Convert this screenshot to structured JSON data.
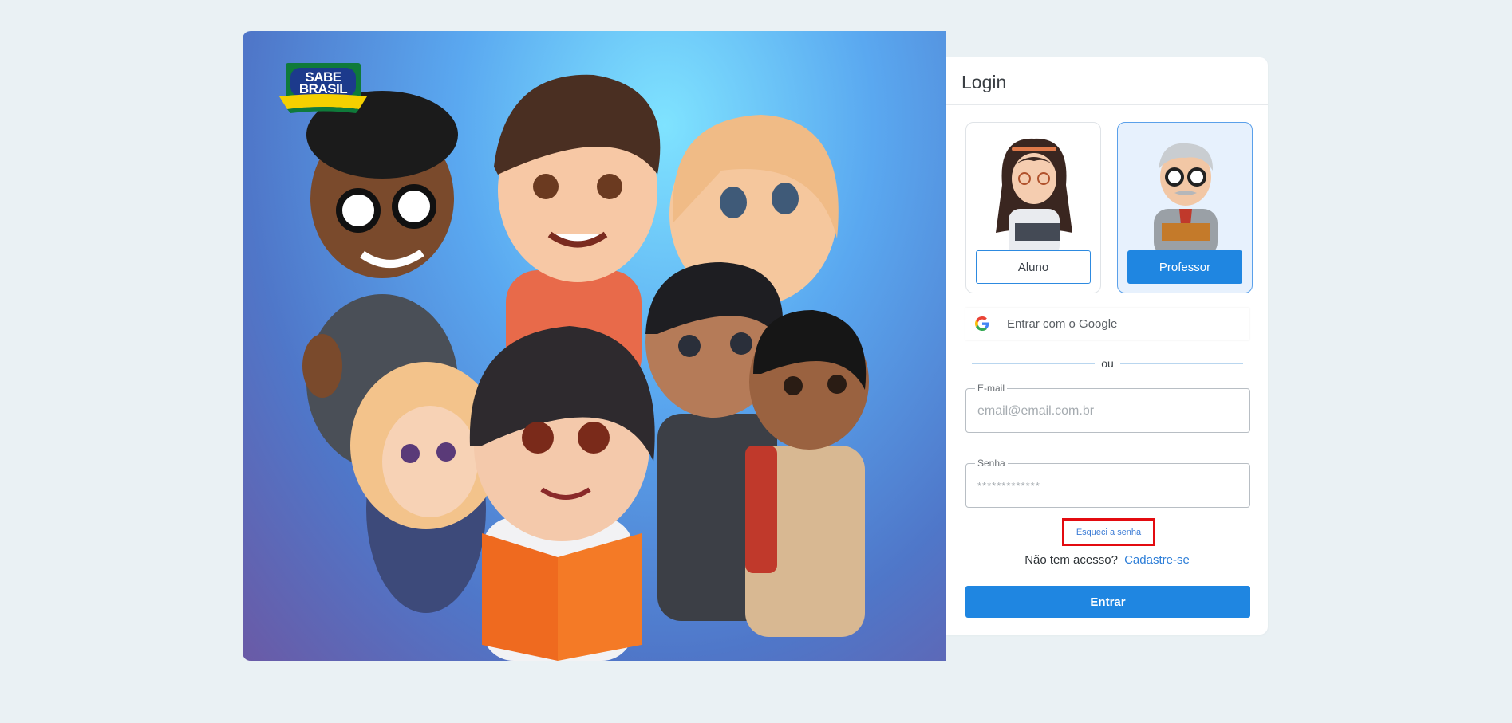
{
  "logo": {
    "line1": "SABE",
    "line2": "BRASIL"
  },
  "login": {
    "title": "Login",
    "roles": [
      {
        "label": "Aluno",
        "selected": false
      },
      {
        "label": "Professor",
        "selected": true
      }
    ],
    "google_label": "Entrar com o Google",
    "divider_text": "ou",
    "email": {
      "label": "E-mail",
      "placeholder": "email@email.com.br"
    },
    "password": {
      "label": "Senha",
      "placeholder": "*************"
    },
    "forgot_link": "Esqueci a senha",
    "no_access_text": "Não tem acesso?",
    "signup_link": "Cadastre-se",
    "submit_label": "Entrar"
  },
  "colors": {
    "background": "#eaf1f4",
    "primary": "#1f86e1",
    "highlight_box": "#e30b10"
  }
}
